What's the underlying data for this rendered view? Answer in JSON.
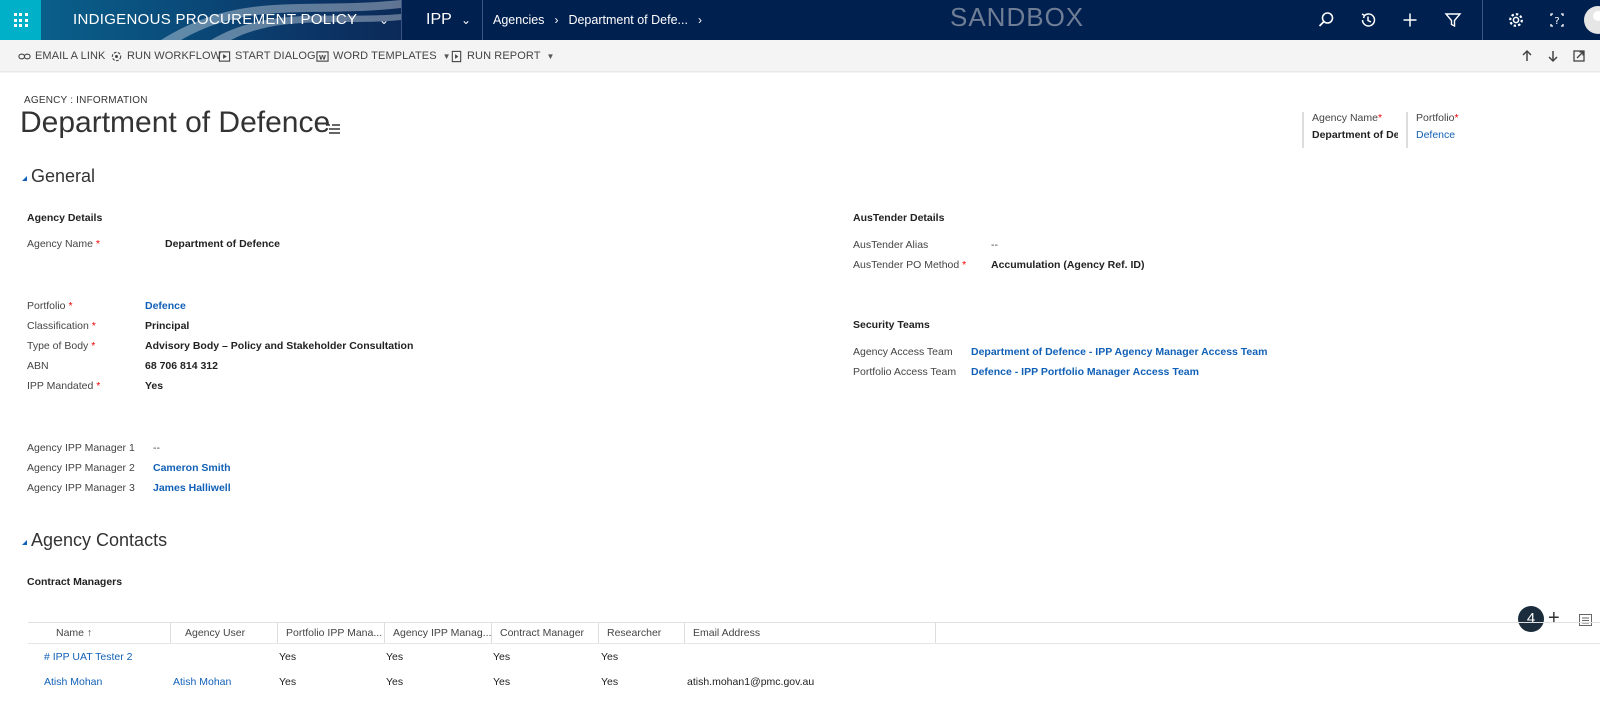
{
  "topbar": {
    "app_name": "INDIGENOUS PROCUREMENT POLICY",
    "module": "IPP",
    "breadcrumb": [
      "Agencies",
      "Department of Defe..."
    ],
    "watermark": "SANDBOX"
  },
  "commands": {
    "email_link": "EMAIL A LINK",
    "run_workflow": "RUN WORKFLOW",
    "start_dialog": "START DIALOG",
    "word_templates": "WORD TEMPLATES",
    "run_report": "RUN REPORT"
  },
  "record": {
    "entity_type": "AGENCY : INFORMATION",
    "title": "Department of Defence",
    "header_fields": [
      {
        "label": "Agency Name",
        "value": "Department of Defence"
      },
      {
        "label": "Portfolio",
        "value": "Defence"
      }
    ]
  },
  "general": {
    "title": "General",
    "agency_details": {
      "title": "Agency Details",
      "agency_name": {
        "label": "Agency Name",
        "value": "Department of Defence"
      },
      "portfolio": {
        "label": "Portfolio",
        "value": "Defence"
      },
      "classification": {
        "label": "Classification",
        "value": "Principal"
      },
      "type_of_body": {
        "label": "Type of Body",
        "value": "Advisory Body – Policy and Stakeholder Consultation"
      },
      "abn": {
        "label": "ABN",
        "value": "68 706 814 312"
      },
      "ipp_mandated": {
        "label": "IPP Mandated",
        "value": "Yes"
      },
      "manager1": {
        "label": "Agency IPP Manager 1",
        "value": "--"
      },
      "manager2": {
        "label": "Agency IPP Manager 2",
        "value": "Cameron Smith"
      },
      "manager3": {
        "label": "Agency IPP Manager 3",
        "value": "James Halliwell"
      }
    },
    "austender": {
      "title": "AusTender Details",
      "alias": {
        "label": "AusTender Alias",
        "value": "--"
      },
      "po_method": {
        "label": "AusTender PO Method",
        "value": "Accumulation (Agency Ref. ID)"
      }
    },
    "security": {
      "title": "Security Teams",
      "agency_team": {
        "label": "Agency Access Team",
        "value": "Department of Defence - IPP Agency Manager Access Team"
      },
      "portfolio_team": {
        "label": "Portfolio Access Team",
        "value": "Defence - IPP Portfolio Manager Access Team"
      }
    }
  },
  "contacts": {
    "title": "Agency Contacts",
    "subgrid_title": "Contract Managers",
    "badge": "4",
    "add": "+",
    "columns": [
      "Name ↑",
      "Agency User",
      "Portfolio IPP Mana...",
      "Agency IPP Manag...",
      "Contract Manager",
      "Researcher",
      "Email Address"
    ],
    "rows": [
      {
        "name": "# IPP UAT Tester 2",
        "agency_user": "",
        "portfolio_mgr": "Yes",
        "agency_mgr": "Yes",
        "contract_mgr": "Yes",
        "researcher": "Yes",
        "email": ""
      },
      {
        "name": "Atish Mohan",
        "agency_user": "Atish Mohan",
        "portfolio_mgr": "Yes",
        "agency_mgr": "Yes",
        "contract_mgr": "Yes",
        "researcher": "Yes",
        "email": "atish.mohan1@pmc.gov.au"
      }
    ]
  },
  "colors": {
    "topbar": "#002050",
    "waffle": "#00b0c8",
    "link": "#1160b7",
    "required": "#ee0000"
  }
}
